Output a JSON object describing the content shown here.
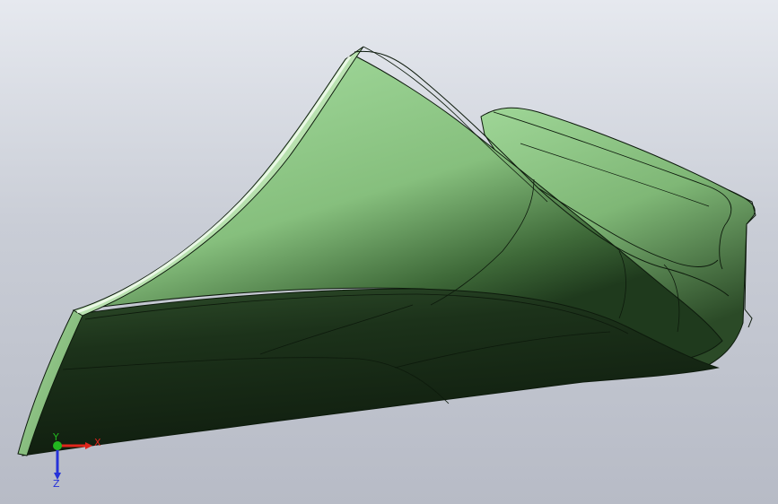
{
  "viewport": {
    "background_top": "#e6e9ef",
    "background_bottom": "#b7bbc6"
  },
  "model": {
    "surface_color_light": "#93cc8a",
    "surface_color_dark": "#152414",
    "edge_color": "#0d1a0c",
    "highlight_color": "#f2fbef"
  },
  "triad": {
    "x_label": "X",
    "y_label": "Y",
    "z_label": "Z",
    "x_color": "#e0261c",
    "y_color": "#22b81f",
    "z_color": "#2632d9"
  }
}
